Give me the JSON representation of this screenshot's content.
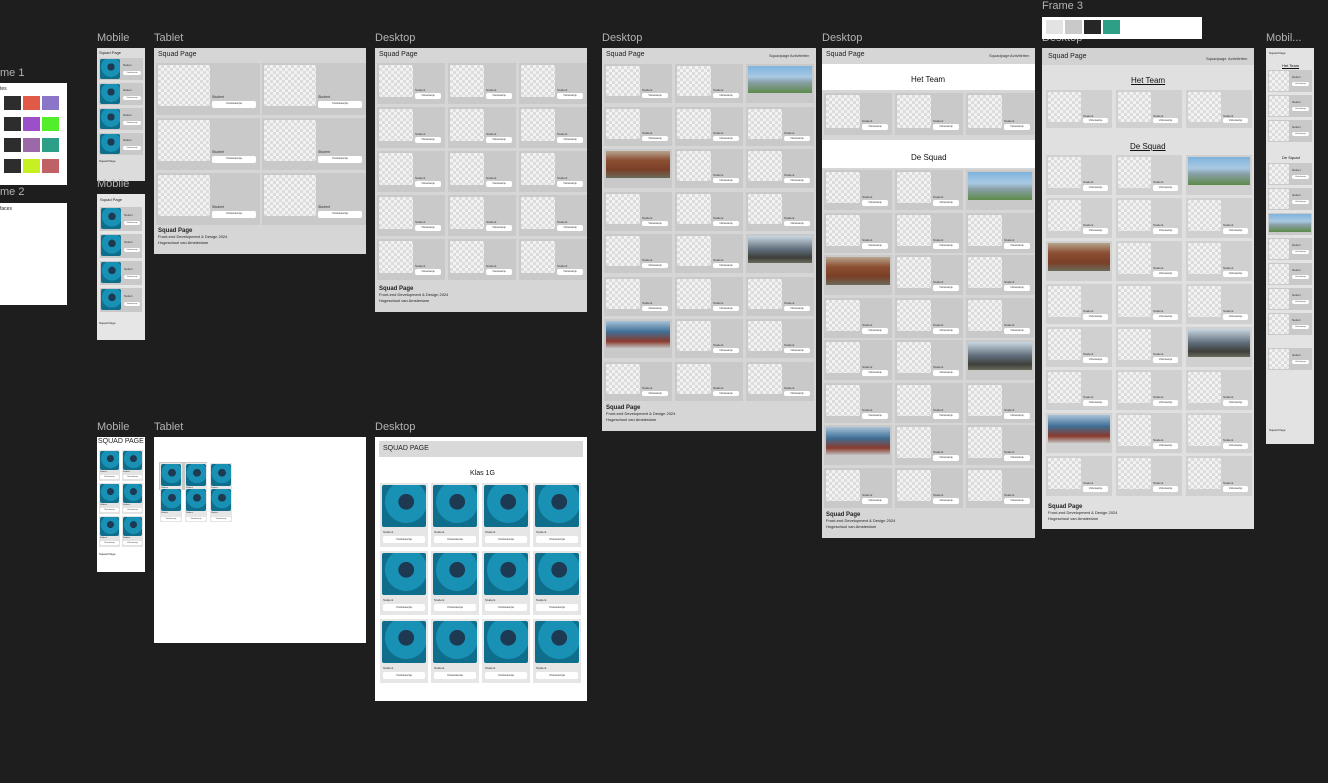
{
  "frame_labels": {
    "frame1": "me 1",
    "frame2": "me 2",
    "frame3": "Frame 3",
    "mobile": "Mobile",
    "tablet": "Tablet",
    "desktop": "Desktop",
    "mobile_cut": "Mobil..."
  },
  "frame1": {
    "subtitle": "tes",
    "colors": [
      [
        "#2d2d2d",
        "#e05a47",
        "#8a75c6"
      ],
      [
        "#2d2d2d",
        "#9b4fc9",
        "#52ee2c"
      ],
      [
        "#2d2d2d",
        "#9b69a7",
        "#2d9f87"
      ],
      [
        "#2d2d2d",
        "#c6f021",
        "#c06166"
      ]
    ]
  },
  "frame2": {
    "text": "faces"
  },
  "frame3": {
    "colors": [
      "#e3e3e3",
      "#c9c9c9",
      "#262626",
      "#2d9f87"
    ]
  },
  "page": {
    "title": "Squad Page",
    "title_upper": "SQUAD PAGE",
    "nav_home": "Squadpage",
    "nav_members": "Activiteiten",
    "het_team": "Het Team",
    "de_squad": "De Squad",
    "klas": "Klas 1G",
    "student": "Student",
    "button": "Visitekaartje",
    "footer_title": "Squad Page",
    "footer_line1": "Front-end Development & Design 2024",
    "footer_line2": "Hogeschool van Amsterdam"
  }
}
